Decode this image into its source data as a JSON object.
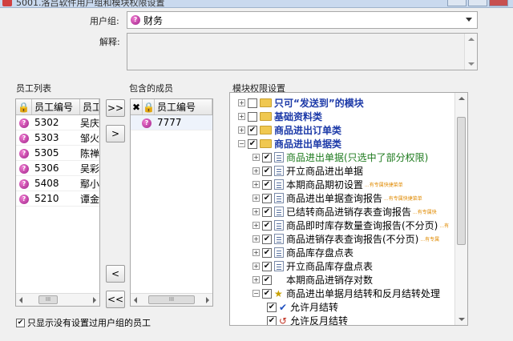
{
  "window": {
    "title": "5001.洛吕软件用户组和模块权限设置"
  },
  "form": {
    "group_label": "用户组:",
    "group_value": "财务",
    "desc_label": "解释:",
    "desc_value": ""
  },
  "employees": {
    "title": "员工列表",
    "col_id": "员工编号",
    "col_name": "员工",
    "rows": [
      {
        "id": "5302",
        "name": "吴庆"
      },
      {
        "id": "5303",
        "name": "邹火"
      },
      {
        "id": "5305",
        "name": "陈禅"
      },
      {
        "id": "5306",
        "name": "吴彩"
      },
      {
        "id": "5408",
        "name": "鄢小"
      },
      {
        "id": "5210",
        "name": "谭金"
      }
    ]
  },
  "members": {
    "title": "包含的成员",
    "col_id": "员工编号",
    "rows": [
      {
        "id": "7777"
      }
    ]
  },
  "buttons": {
    "add_all": ">>",
    "add": ">",
    "remove": "<",
    "remove_all": "<<"
  },
  "modules": {
    "title": "模块权限设置",
    "nodes": [
      {
        "label": "只可“发送到”的模块",
        "tag": ""
      },
      {
        "label": "基础资料类",
        "tag": ""
      },
      {
        "label": "商品进出订单类",
        "tag": ""
      },
      {
        "label": "商品进出单据类",
        "tag": ""
      },
      {
        "label": "商品进出单据(只选中了部分权限)",
        "tag": ""
      },
      {
        "label": "开立商品进出单据",
        "tag": ""
      },
      {
        "label": "本期商品期初设置",
        "tag": "...有专属快捷菜单"
      },
      {
        "label": "商品进出单据查询报告",
        "tag": "...有专属快捷菜单"
      },
      {
        "label": "已结转商品进销存表查询报告",
        "tag": "...有专属快"
      },
      {
        "label": "商品即时库存数量查询报告(不分页)",
        "tag": "...有"
      },
      {
        "label": "商品进销存表查询报告(不分页)",
        "tag": "...有专属"
      },
      {
        "label": "商品库存盘点表",
        "tag": ""
      },
      {
        "label": "开立商品库存盘点表",
        "tag": ""
      },
      {
        "label": "本期商品进销存对数",
        "tag": ""
      },
      {
        "label": "商品进出单据月结转和反月结转处理",
        "tag": ""
      },
      {
        "label": "允许月结转",
        "tag": ""
      },
      {
        "label": "允许反月结转",
        "tag": ""
      }
    ]
  },
  "footer": {
    "only_unassigned": "只显示没有设置过用户组的员工"
  }
}
